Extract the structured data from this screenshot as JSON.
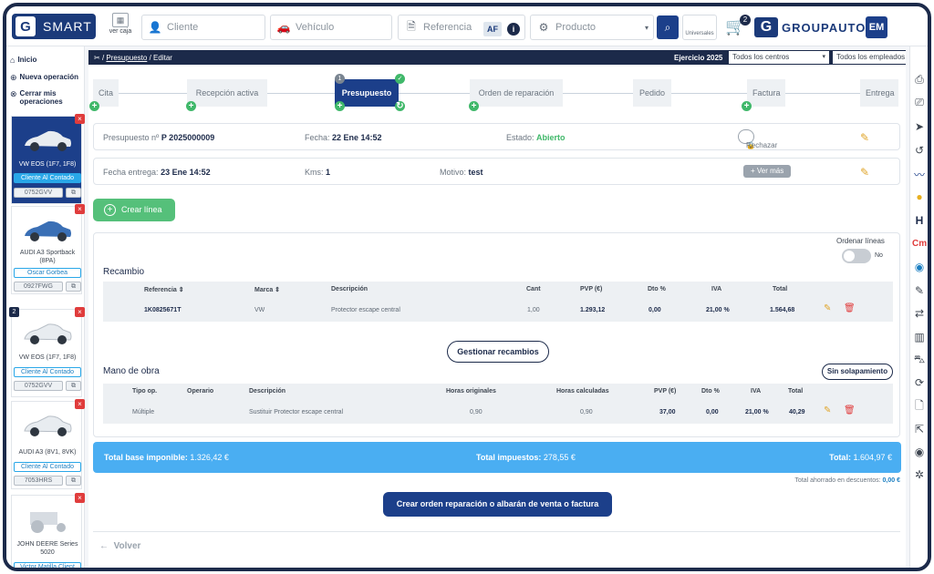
{
  "topbar": {
    "logo_text": "SMART",
    "logo_letter": "G",
    "caja_label": "ver caja",
    "cliente_placeholder": "Cliente",
    "vehiculo_placeholder": "Vehículo",
    "referencia_placeholder": "Referencia",
    "af_badge": "AF",
    "info_badge": "i",
    "producto_placeholder": "Producto",
    "universales_label": "Universales",
    "cart_count": "2",
    "brand_text": "GROUPAUTO",
    "brand_letter": "G",
    "user_initials": "EM"
  },
  "sidebar": {
    "nav": [
      {
        "icon": "home-icon",
        "label": "Inicio"
      },
      {
        "icon": "plus-circle-icon",
        "label": "Nueva operación"
      },
      {
        "icon": "close-circle-icon",
        "label": "Cerrar mis operaciones"
      }
    ],
    "vehicles": [
      {
        "name": "VW EOS (1F7, 1F8)",
        "client": "Cliente Al Contado",
        "plate": "0752GVV",
        "active": true,
        "count": ""
      },
      {
        "name": "AUDI A3 Sportback (8PA)",
        "client": "Oscar Gorbea",
        "plate": "0927FWG",
        "active": false,
        "count": ""
      },
      {
        "name": "VW EOS (1F7, 1F8)",
        "client": "Cliente Al Contado",
        "plate": "0752GVV",
        "active": false,
        "count": "2"
      },
      {
        "name": "AUDI A3 (8V1, 8VK)",
        "client": "Cliente Al Contado",
        "plate": "7053HRS",
        "active": false,
        "count": ""
      },
      {
        "name": "JOHN DEERE Series 5020",
        "client": "Victor Matilla Client",
        "plate": "",
        "active": false,
        "count": ""
      }
    ]
  },
  "strip": {
    "breadcrumb_sep1": "/",
    "breadcrumb_link": "Presupuesto",
    "breadcrumb_sep2": "/",
    "breadcrumb_current": "Editar",
    "ejercicio": "Ejercicio 2025",
    "centros": "Todos los centros",
    "empleados": "Todos los empleados"
  },
  "steps": [
    {
      "label": "Cita"
    },
    {
      "label": "Recepción activa"
    },
    {
      "label": "Presupuesto"
    },
    {
      "label": "Orden de reparación"
    },
    {
      "label": "Pedido"
    },
    {
      "label": "Factura"
    },
    {
      "label": "Entrega"
    }
  ],
  "step_badge_count": "1",
  "info": {
    "presupuesto_label": "Presupuesto nº",
    "presupuesto_value": "P 2025000009",
    "fecha_label": "Fecha:",
    "fecha_value": "22 Ene 14:52",
    "estado_label": "Estado:",
    "estado_value": "Abierto",
    "rechazar": "Rechazar",
    "fecha_entrega_label": "Fecha entrega:",
    "fecha_entrega_value": "23 Ene 14:52",
    "kms_label": "Kms:",
    "kms_value": "1",
    "motivo_label": "Motivo:",
    "motivo_value": "test",
    "ver_mas": "+ Ver más"
  },
  "crear_linea": "Crear línea",
  "ordenar": {
    "label": "Ordenar líneas",
    "state": "No"
  },
  "recambio": {
    "title": "Recambio",
    "headers": [
      "Referencia",
      "Marca",
      "Descripción",
      "Cant",
      "PVP (€)",
      "Dto %",
      "IVA",
      "Total"
    ],
    "row": [
      "1K0825671T",
      "VW",
      "Protector escape central",
      "1,00",
      "1.293,12",
      "0,00",
      "21,00 %",
      "1.564,68"
    ],
    "gestionar": "Gestionar recambios"
  },
  "mano_obra": {
    "title": "Mano de obra",
    "sin_solapamiento": "Sin solapamiento",
    "headers": [
      "Tipo op.",
      "Operario",
      "Descripción",
      "Horas originales",
      "Horas calculadas",
      "PVP (€)",
      "Dto %",
      "IVA",
      "Total"
    ],
    "row": [
      "Múltiple",
      "",
      "Sustituir Protector escape central",
      "0,90",
      "0,90",
      "37,00",
      "0,00",
      "21,00 %",
      "40,29"
    ]
  },
  "totals": {
    "base_label": "Total base imponible:",
    "base_value": "1.326,42 €",
    "impuestos_label": "Total impuestos:",
    "impuestos_value": "278,55 €",
    "total_label": "Total:",
    "total_value": "1.604,97 €",
    "ahorro_label": "Total ahorrado en descuentos:",
    "ahorro_value": "0,00 €"
  },
  "cta": "Crear orden reparación o albarán de venta o factura",
  "volver": "Volver",
  "colors": {
    "navy": "#1c2a4a",
    "primary": "#1c3f8a",
    "green": "#40b86a",
    "blue": "#4aaef2",
    "red": "#e03c3c"
  }
}
